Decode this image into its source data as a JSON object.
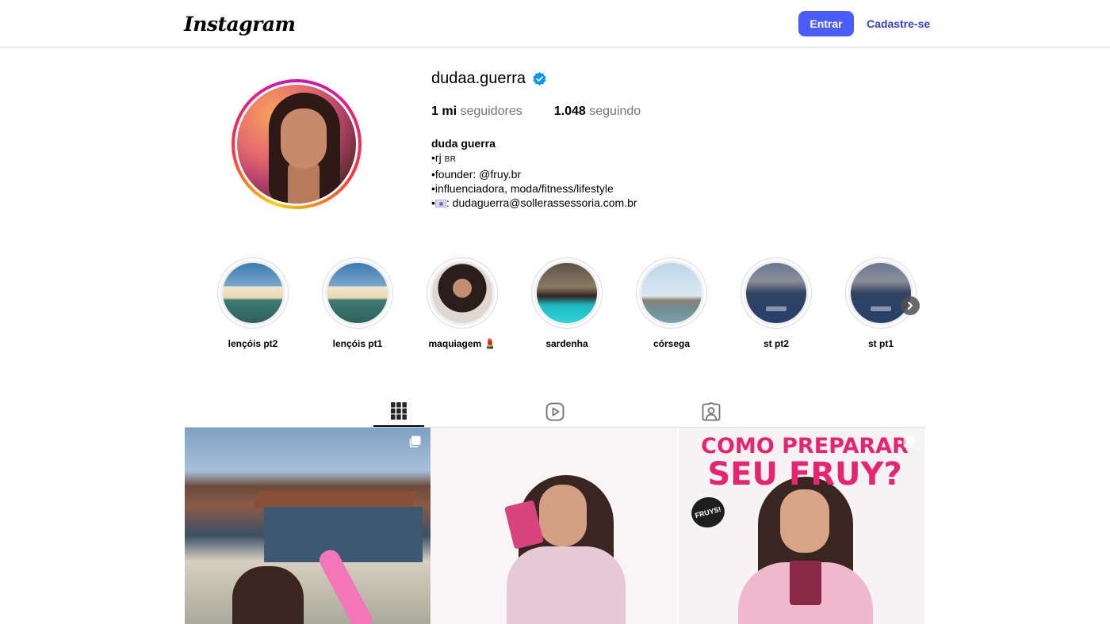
{
  "header": {
    "logo_text": "Instagram",
    "login_label": "Entrar",
    "signup_label": "Cadastre-se"
  },
  "profile": {
    "username": "dudaa.guerra",
    "verified": true,
    "followers_count": "1 mi",
    "followers_label": "seguidores",
    "following_count": "1.048",
    "following_label": "seguindo",
    "full_name": "duda guerra",
    "bio_line_1_prefix": "•rj",
    "bio_line_1_flag": "BR",
    "bio_line_2": "•founder: @fruy.br",
    "bio_line_3": "•influenciadora, moda/fitness/lifestyle",
    "bio_line_4_prefix": "•",
    "bio_line_4_text": ": dudaguerra@sollerassessoria.com.br"
  },
  "highlights": [
    {
      "label": "lençóis pt2"
    },
    {
      "label": "lençóis pt1"
    },
    {
      "label": "maquiagem 💄"
    },
    {
      "label": "sardenha"
    },
    {
      "label": "córsega"
    },
    {
      "label": "st pt2"
    },
    {
      "label": "st pt1"
    }
  ],
  "tabs": [
    {
      "icon": "grid-icon",
      "active": true
    },
    {
      "icon": "reels-icon",
      "active": false
    },
    {
      "icon": "tagged-icon",
      "active": false
    }
  ],
  "posts": [
    {
      "type": "carousel"
    },
    {
      "type": "image"
    },
    {
      "type": "carousel",
      "overlay_line_1": "COMO PREPARAR",
      "overlay_line_2": "SEU FRUY?",
      "badge": "FRUYS!"
    }
  ],
  "colors": {
    "primary_button": "#4a5df9",
    "link": "#3143c7",
    "verified": "#0095f6",
    "muted_text": "#737373",
    "border": "#dbdbdb"
  }
}
